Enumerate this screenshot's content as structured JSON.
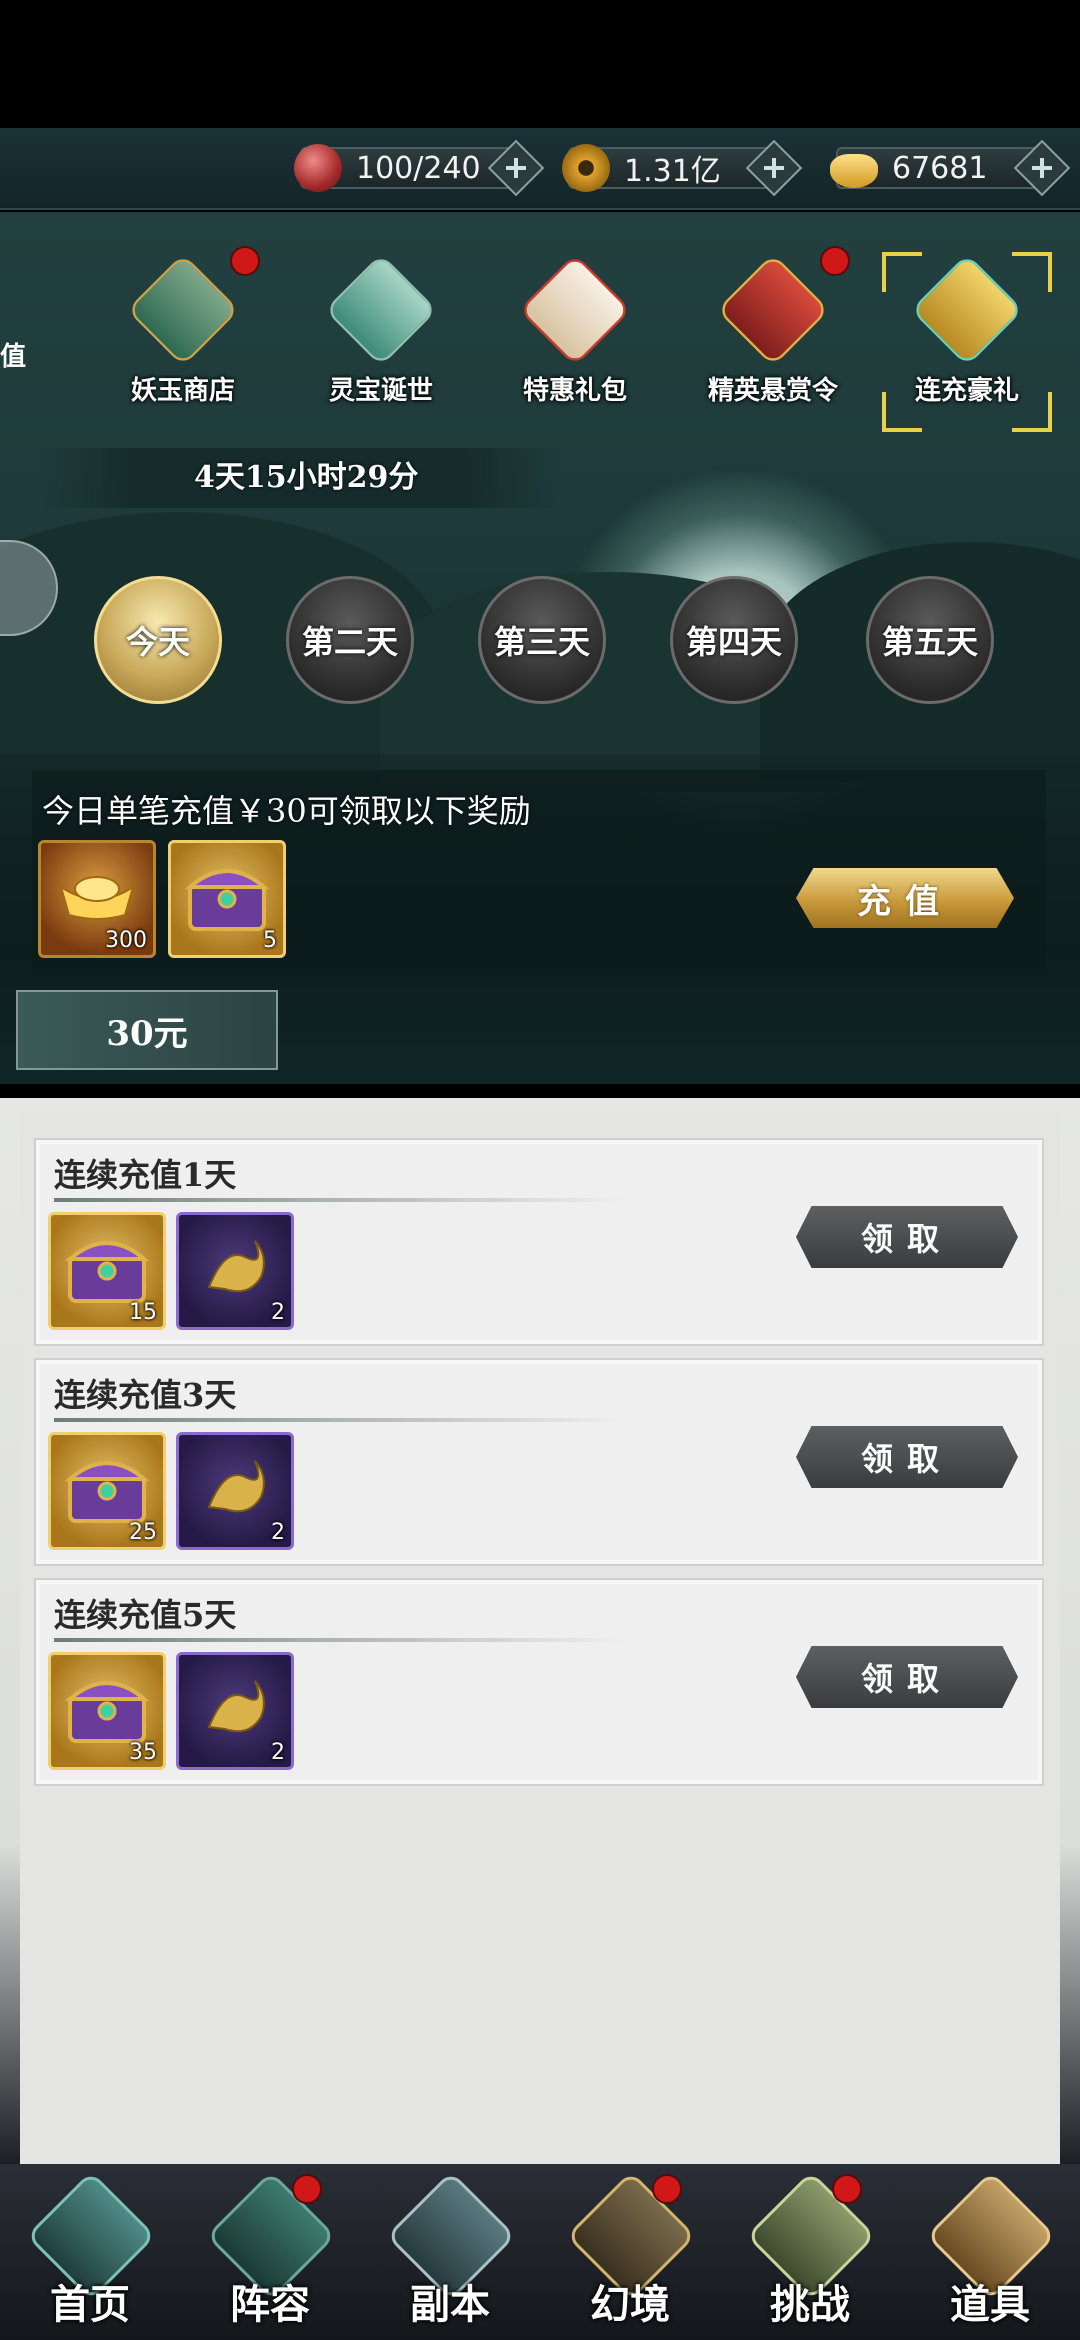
{
  "resources": [
    {
      "icon": "stamina-icon",
      "value": "100/240"
    },
    {
      "icon": "copper-coin-icon",
      "value": "1.31亿"
    },
    {
      "icon": "gold-ingot-icon",
      "value": "67681"
    }
  ],
  "tabs": [
    {
      "label": "妖玉商店",
      "icon": "shop-icon",
      "badge": true
    },
    {
      "label": "灵宝诞世",
      "icon": "treasure-icon",
      "badge": false
    },
    {
      "label": "特惠礼包",
      "icon": "gift-box-icon",
      "badge": false
    },
    {
      "label": "精英悬赏令",
      "icon": "bounty-icon",
      "badge": true
    },
    {
      "label": "连充豪礼",
      "icon": "recharge-gift-icon",
      "badge": false,
      "selected": true
    }
  ],
  "partial_tab_label": "值",
  "timer": "4天15小时29分",
  "days": [
    "今天",
    "第二天",
    "第三天",
    "第四天",
    "第五天"
  ],
  "daily": {
    "text": "今日单笔充值￥30可领取以下奖励",
    "items": [
      {
        "icon": "gold-ingot-icon",
        "count": "300"
      },
      {
        "icon": "purple-chest-icon",
        "count": "5"
      }
    ],
    "button": "充值"
  },
  "amount_tab": "30元",
  "rows": [
    {
      "title": "连续充值1天",
      "items": [
        {
          "icon": "purple-chest-icon",
          "count": "15"
        },
        {
          "icon": "golden-dragon-icon",
          "count": "2"
        }
      ],
      "button": "领取"
    },
    {
      "title": "连续充值3天",
      "items": [
        {
          "icon": "purple-chest-icon",
          "count": "25"
        },
        {
          "icon": "golden-dragon-icon",
          "count": "2"
        }
      ],
      "button": "领取"
    },
    {
      "title": "连续充值5天",
      "items": [
        {
          "icon": "purple-chest-icon",
          "count": "35"
        },
        {
          "icon": "golden-dragon-icon",
          "count": "2"
        }
      ],
      "button": "领取"
    }
  ],
  "nav": [
    {
      "label": "首页",
      "icon": "home-icon",
      "badge": false
    },
    {
      "label": "阵容",
      "icon": "lineup-icon",
      "badge": true
    },
    {
      "label": "副本",
      "icon": "dungeon-icon",
      "badge": false
    },
    {
      "label": "幻境",
      "icon": "illusion-icon",
      "badge": true
    },
    {
      "label": "挑战",
      "icon": "challenge-icon",
      "badge": true
    },
    {
      "label": "道具",
      "icon": "bag-icon",
      "badge": false
    }
  ]
}
